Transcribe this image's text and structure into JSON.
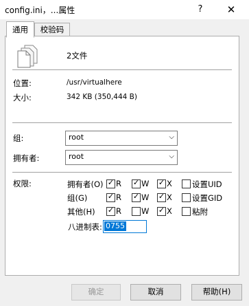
{
  "window": {
    "title": "config.ini，...属性",
    "help_icon": "?",
    "close_icon": "✕"
  },
  "tabs": [
    {
      "label": "通用",
      "active": true
    },
    {
      "label": "校验码",
      "active": false
    }
  ],
  "summary": {
    "icon": "files-icon",
    "count_text": "2文件"
  },
  "location": {
    "label": "位置:",
    "value": "/usr/virtualhere"
  },
  "size": {
    "label": "大小:",
    "value": "342 KB (350,444 B)"
  },
  "group": {
    "label": "组:",
    "value": "root"
  },
  "owner": {
    "label": "拥有者:",
    "value": "root"
  },
  "permissions": {
    "label": "权限:",
    "rows": [
      {
        "label": "拥有者(O)",
        "r": true,
        "w": true,
        "x": true,
        "extra_label": "设置UID",
        "extra": false
      },
      {
        "label": "组(G)",
        "r": true,
        "w": true,
        "x": true,
        "extra_label": "设置GID",
        "extra": false
      },
      {
        "label": "其他(H)",
        "r": true,
        "w": false,
        "x": true,
        "extra_label": "粘附",
        "extra": false
      }
    ],
    "r_label": "R",
    "w_label": "W",
    "x_label": "X",
    "octal_label": "八进制表:",
    "octal_value": "0755"
  },
  "buttons": {
    "ok": "确定",
    "cancel": "取消",
    "help": "帮助(H)"
  }
}
